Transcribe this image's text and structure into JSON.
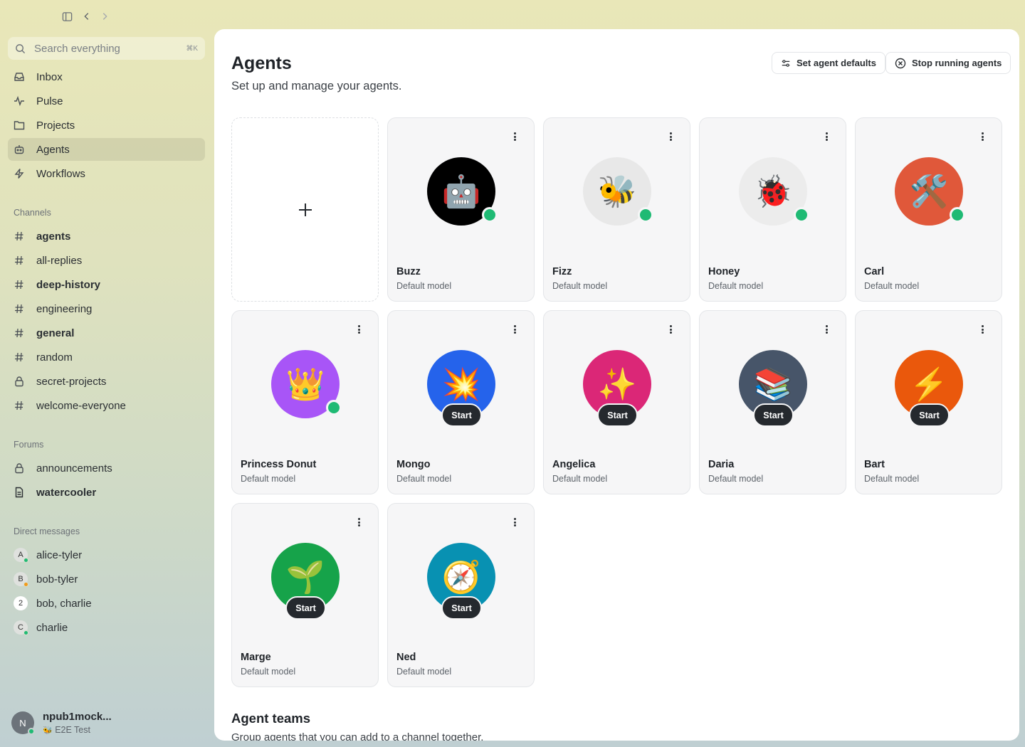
{
  "sidebar": {
    "search": {
      "placeholder": "Search everything",
      "shortcut": "⌘K"
    },
    "nav": [
      {
        "label": "Inbox",
        "icon": "inbox-icon"
      },
      {
        "label": "Pulse",
        "icon": "pulse-icon"
      },
      {
        "label": "Projects",
        "icon": "projects-icon"
      },
      {
        "label": "Agents",
        "icon": "agents-icon",
        "active": true
      },
      {
        "label": "Workflows",
        "icon": "bolt-icon"
      }
    ],
    "channels_label": "Channels",
    "channels": [
      {
        "label": "agents",
        "icon": "hash-icon",
        "bold": true
      },
      {
        "label": "all-replies",
        "icon": "hash-icon",
        "bold": false
      },
      {
        "label": "deep-history",
        "icon": "hash-icon",
        "bold": true
      },
      {
        "label": "engineering",
        "icon": "hash-icon",
        "bold": false
      },
      {
        "label": "general",
        "icon": "hash-icon",
        "bold": true
      },
      {
        "label": "random",
        "icon": "hash-icon",
        "bold": false
      },
      {
        "label": "secret-projects",
        "icon": "lock-icon",
        "bold": false
      },
      {
        "label": "welcome-everyone",
        "icon": "hash-icon",
        "bold": false
      }
    ],
    "forums_label": "Forums",
    "forums": [
      {
        "label": "announcements",
        "icon": "lock-icon",
        "bold": false
      },
      {
        "label": "watercooler",
        "icon": "document-icon",
        "bold": true
      }
    ],
    "dm_label": "Direct messages",
    "dms": [
      {
        "label": "alice-tyler",
        "initial": "A",
        "status_color": "#1fba74"
      },
      {
        "label": "bob-tyler",
        "initial": "B",
        "status_color": "#f29a1a"
      },
      {
        "label": "bob, charlie",
        "initial": "2",
        "status_color": ""
      },
      {
        "label": "charlie",
        "initial": "C",
        "status_color": "#1fba74"
      }
    ],
    "user": {
      "initial": "N",
      "name": "npub1mock...",
      "status": "E2E Test",
      "status_emoji": "🐝"
    }
  },
  "main": {
    "title": "Agents",
    "subtitle": "Set up and manage your agents.",
    "set_defaults_label": "Set agent defaults",
    "stop_label": "Stop running agents",
    "start_label": "Start",
    "teams_title": "Agent teams",
    "teams_subtitle": "Group agents that you can add to a channel together."
  },
  "agents": [
    {
      "name": "Buzz",
      "model": "Default model",
      "emoji": "🤖",
      "bg": "#000000",
      "running": true
    },
    {
      "name": "Fizz",
      "model": "Default model",
      "emoji": "🐝",
      "bg": "#e8e8e8",
      "running": true
    },
    {
      "name": "Honey",
      "model": "Default model",
      "emoji": "🐞",
      "bg": "#ececec",
      "running": true
    },
    {
      "name": "Carl",
      "model": "Default model",
      "emoji": "🛠️",
      "bg": "#e0583a",
      "running": true
    },
    {
      "name": "Princess Donut",
      "model": "Default model",
      "emoji": "👑",
      "bg": "#a855f7",
      "running": true
    },
    {
      "name": "Mongo",
      "model": "Default model",
      "emoji": "💥",
      "bg": "#2563eb",
      "running": false
    },
    {
      "name": "Angelica",
      "model": "Default model",
      "emoji": "✨",
      "bg": "#db2777",
      "running": false
    },
    {
      "name": "Daria",
      "model": "Default model",
      "emoji": "📚",
      "bg": "#475569",
      "running": false
    },
    {
      "name": "Bart",
      "model": "Default model",
      "emoji": "⚡",
      "bg": "#ea580c",
      "running": false
    },
    {
      "name": "Marge",
      "model": "Default model",
      "emoji": "🌱",
      "bg": "#16a34a",
      "running": false
    },
    {
      "name": "Ned",
      "model": "Default model",
      "emoji": "🧭",
      "bg": "#0891b2",
      "running": false
    }
  ]
}
